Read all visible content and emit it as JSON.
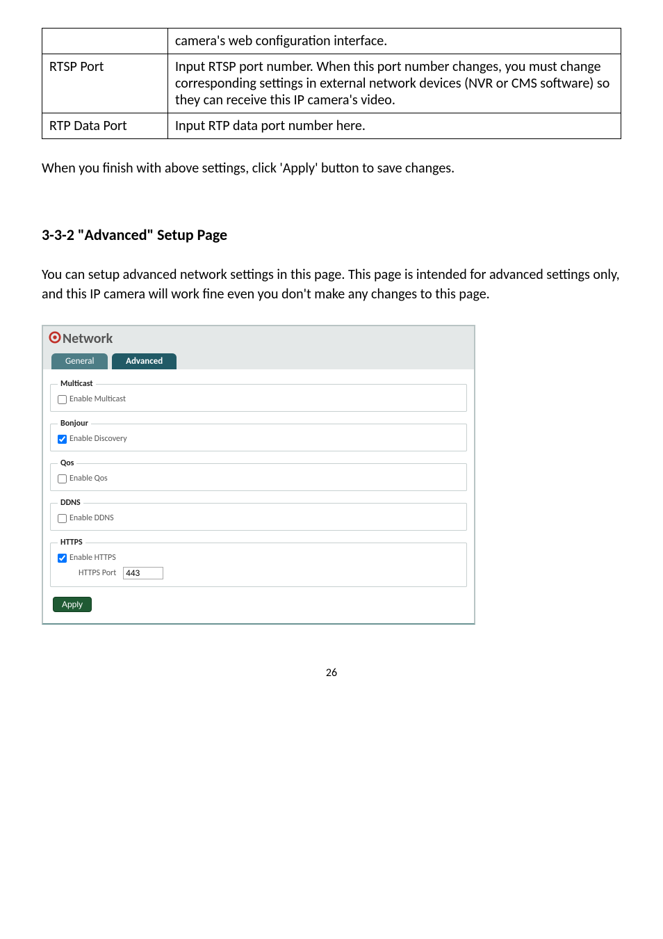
{
  "table": {
    "rows": [
      {
        "col0": "",
        "col1": "camera's web configuration interface."
      },
      {
        "col0": "RTSP Port",
        "col1": "Input RTSP port number. When this port number changes, you must change corresponding settings in external network devices (NVR or CMS software) so they can receive this IP camera's video."
      },
      {
        "col0": "RTP Data Port",
        "col1": "Input RTP data port number here."
      }
    ]
  },
  "apply_note": "When you finish with above settings, click 'Apply' button to save changes.",
  "section_title": "3-3-2 \"Advanced\" Setup Page",
  "section_desc": "You can setup advanced network settings in this page. This page is intended for advanced settings only, and this IP camera will work fine even you don't make any changes to this page.",
  "ui": {
    "title": "Network",
    "tabs": {
      "general": "General",
      "advanced": "Advanced"
    },
    "multicast": {
      "legend": "Multicast",
      "label": "Enable Multicast",
      "checked": false
    },
    "bonjour": {
      "legend": "Bonjour",
      "label": "Enable Discovery",
      "checked": true
    },
    "qos": {
      "legend": "Qos",
      "label": "Enable Qos",
      "checked": false
    },
    "ddns": {
      "legend": "DDNS",
      "label": "Enable DDNS",
      "checked": false
    },
    "https": {
      "legend": "HTTPS",
      "label": "Enable HTTPS",
      "checked": true,
      "port_label": "HTTPS Port",
      "port_value": "443"
    },
    "apply": "Apply"
  },
  "page_number": "26"
}
